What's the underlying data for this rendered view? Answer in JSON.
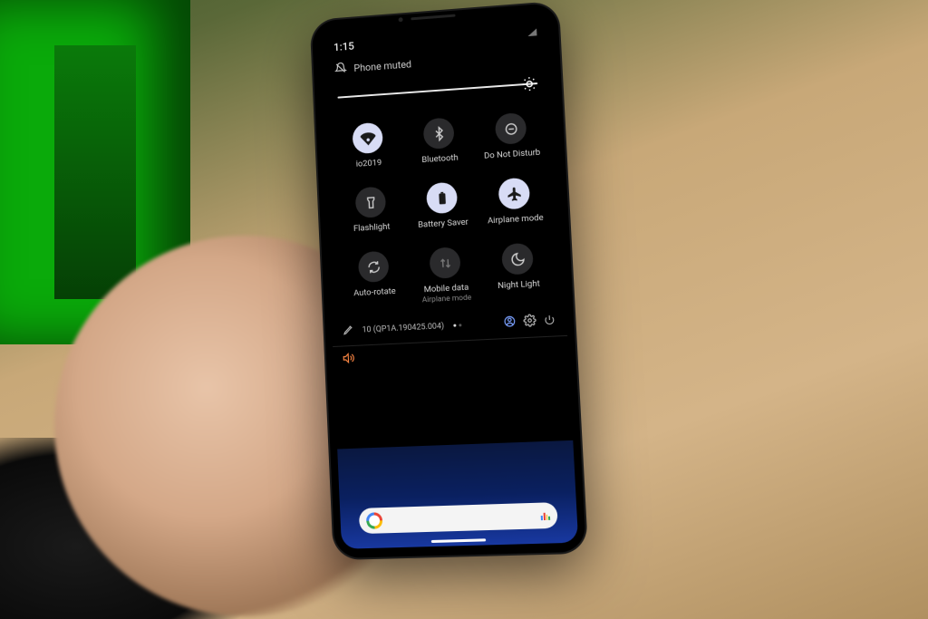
{
  "statusbar": {
    "time": "1:15"
  },
  "notification": {
    "mode_label": "Phone muted"
  },
  "brightness": {
    "value_percent": 100
  },
  "tiles": [
    {
      "id": "wifi",
      "label": "io2019",
      "sublabel": "",
      "active": true,
      "icon": "wifi"
    },
    {
      "id": "bluetooth",
      "label": "Bluetooth",
      "sublabel": "",
      "active": false,
      "icon": "bluetooth"
    },
    {
      "id": "dnd",
      "label": "Do Not Disturb",
      "sublabel": "",
      "active": false,
      "icon": "dnd"
    },
    {
      "id": "flashlight",
      "label": "Flashlight",
      "sublabel": "",
      "active": false,
      "icon": "flashlight"
    },
    {
      "id": "battery_saver",
      "label": "Battery Saver",
      "sublabel": "",
      "active": true,
      "icon": "battery"
    },
    {
      "id": "airplane",
      "label": "Airplane mode",
      "sublabel": "",
      "active": true,
      "icon": "airplane"
    },
    {
      "id": "autorotate",
      "label": "Auto-rotate",
      "sublabel": "",
      "active": false,
      "icon": "rotate"
    },
    {
      "id": "mobiledata",
      "label": "Mobile data",
      "sublabel": "Airplane mode",
      "active": false,
      "icon": "data"
    },
    {
      "id": "nightlight",
      "label": "Night Light",
      "sublabel": "",
      "active": false,
      "icon": "moon"
    }
  ],
  "footer": {
    "build": "10 (QP1A.190425.004)",
    "page_current": 1,
    "page_total": 2
  },
  "colors": {
    "tile_active_bg": "#d8dcf5",
    "tile_inactive_bg": "#2a2a2c",
    "bg": "#000000",
    "text": "#e8e8e8"
  }
}
